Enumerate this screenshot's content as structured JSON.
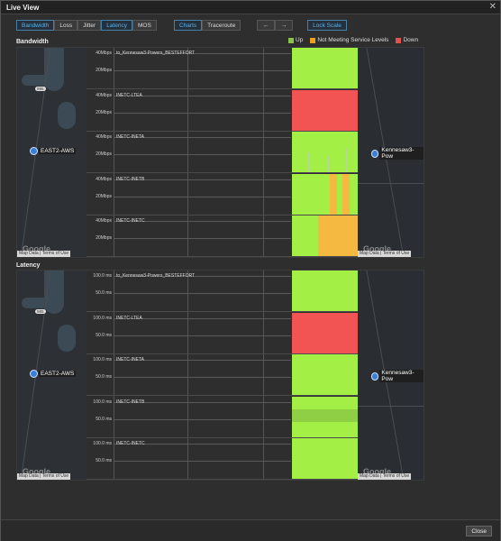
{
  "window": {
    "title": "Live View",
    "close_glyph": "✕"
  },
  "toolbar": {
    "group1": [
      {
        "label": "Bandwidth",
        "active": true
      },
      {
        "label": "Loss",
        "active": false
      },
      {
        "label": "Jitter",
        "active": false
      },
      {
        "label": "Latency",
        "active": true
      },
      {
        "label": "MOS",
        "active": false
      }
    ],
    "group2": [
      {
        "label": "Charts",
        "active": true
      },
      {
        "label": "Traceroute",
        "active": false
      }
    ],
    "prev_arrow": "←",
    "next_arrow": "→",
    "lock_scale": "Lock Scale"
  },
  "legend": [
    {
      "label": "Up",
      "color": "#8bc34a"
    },
    {
      "label": "Not Meeting Service Levels",
      "color": "#f0a020"
    },
    {
      "label": "Down",
      "color": "#e05050"
    }
  ],
  "colors": {
    "up": "#a3ef45",
    "warn": "#f5b942",
    "down": "#f25454",
    "up_grey": "#b8d89a"
  },
  "bandwidth": {
    "label": "Bandwidth",
    "left_node": "EAST2-AWS",
    "right_node": "Kennesaw3-Pow",
    "map": {
      "google": "Google",
      "map_data": "Map Data",
      "terms": "Terms of Use",
      "road_badge": "985"
    },
    "rows": [
      {
        "name": "to_Kennesaw3-Powers_BESTEFFORT",
        "y_top": "40Mbps",
        "y_mid": "20Mbps",
        "status": "up"
      },
      {
        "name": "INETC-LTEA",
        "y_top": "40Mbps",
        "y_mid": "20Mbps",
        "status": "down"
      },
      {
        "name": "INETC-INETA",
        "y_top": "40Mbps",
        "y_mid": "20Mbps",
        "status": "up_spiky"
      },
      {
        "name": "INETC-INETB",
        "y_top": "40Mbps",
        "y_mid": "20Mbps",
        "status": "up_warn_stripes"
      },
      {
        "name": "INETC-INETC",
        "y_top": "40Mbps",
        "y_mid": "20Mbps",
        "status": "mostly_warn"
      }
    ]
  },
  "latency": {
    "label": "Latency",
    "left_node": "EAST2-AWS",
    "right_node": "Kennesaw3-Pow",
    "map": {
      "google": "Google",
      "map_data": "Map Data",
      "terms": "Terms of Use",
      "road_badge": "985"
    },
    "rows": [
      {
        "name": "to_Kennesaw3-Powers_BESTEFFORT",
        "y_top": "100.0 ms",
        "y_mid": "50.0 ms",
        "status": "up"
      },
      {
        "name": "INETC-LTEA",
        "y_top": "100.0 ms",
        "y_mid": "50.0 ms",
        "status": "down"
      },
      {
        "name": "INETC-INETA",
        "y_top": "100.0 ms",
        "y_mid": "50.0 ms",
        "status": "up"
      },
      {
        "name": "INETC-INETB",
        "y_top": "100.0 ms",
        "y_mid": "50.0 ms",
        "status": "up_band"
      },
      {
        "name": "INETC-INETC",
        "y_top": "100.0 ms",
        "y_mid": "50.0 ms",
        "status": "up"
      }
    ]
  },
  "footer": {
    "close_label": "Close"
  }
}
